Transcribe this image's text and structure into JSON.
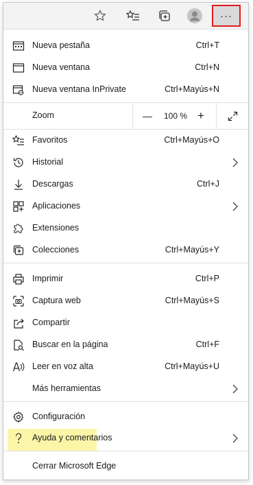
{
  "toolbar": {
    "icons": [
      "star-outline-icon",
      "favorites-list-icon",
      "collections-icon",
      "profile-avatar",
      "more-options-icon"
    ],
    "more_glyph": "···"
  },
  "menu": {
    "new_tab": {
      "label": "Nueva pestaña",
      "shortcut": "Ctrl+T"
    },
    "new_window": {
      "label": "Nueva ventana",
      "shortcut": "Ctrl+N"
    },
    "new_inprivate": {
      "label": "Nueva ventana InPrivate",
      "shortcut": "Ctrl+Mayús+N"
    },
    "zoom": {
      "label": "Zoom",
      "minus": "—",
      "value": "100 %",
      "plus": "+"
    },
    "favorites": {
      "label": "Favoritos",
      "shortcut": "Ctrl+Mayús+O"
    },
    "history": {
      "label": "Historial"
    },
    "downloads": {
      "label": "Descargas",
      "shortcut": "Ctrl+J"
    },
    "apps": {
      "label": "Aplicaciones"
    },
    "extensions": {
      "label": "Extensiones"
    },
    "collections": {
      "label": "Colecciones",
      "shortcut": "Ctrl+Mayús+Y"
    },
    "print": {
      "label": "Imprimir",
      "shortcut": "Ctrl+P"
    },
    "web_capture": {
      "label": "Captura web",
      "shortcut": "Ctrl+Mayús+S"
    },
    "share": {
      "label": "Compartir"
    },
    "find": {
      "label": "Buscar en la página",
      "shortcut": "Ctrl+F"
    },
    "read_aloud": {
      "label": "Leer en voz alta",
      "shortcut": "Ctrl+Mayús+U"
    },
    "more_tools": {
      "label": "Más herramientas"
    },
    "settings": {
      "label": "Configuración"
    },
    "help": {
      "label": "Ayuda y comentarios"
    },
    "close": {
      "label": "Cerrar Microsoft Edge"
    }
  },
  "colors": {
    "highlight": "#fbf5a8",
    "focus_border": "#e01b1b"
  }
}
